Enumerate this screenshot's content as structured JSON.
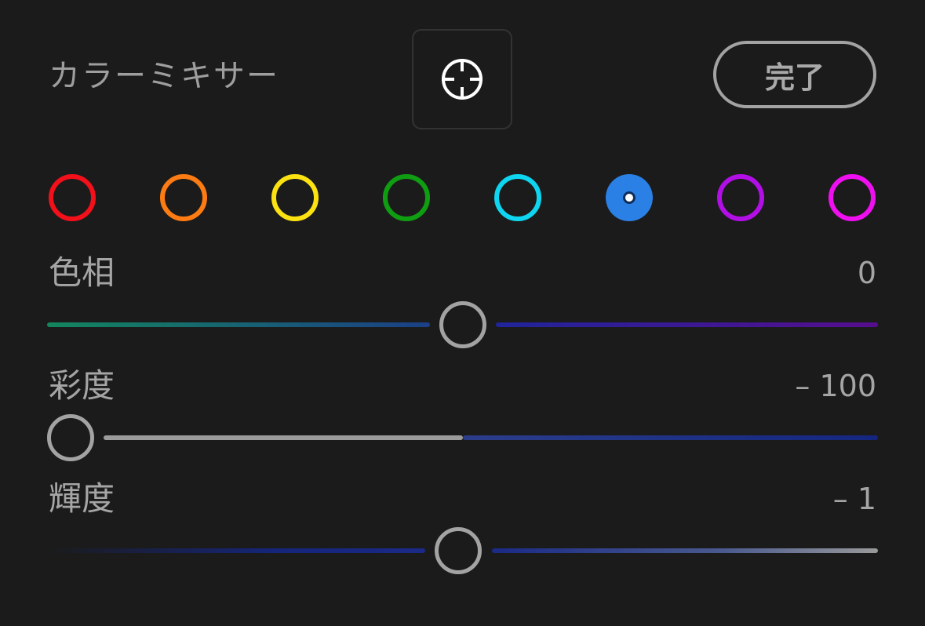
{
  "header": {
    "title": "カラーミキサー",
    "target_tool_icon": "target-crosshair-icon",
    "done_label": "完了"
  },
  "swatches": [
    {
      "name": "red",
      "color": "#f2101a",
      "selected": false
    },
    {
      "name": "orange",
      "color": "#fc7c13",
      "selected": false
    },
    {
      "name": "yellow",
      "color": "#fce211",
      "selected": false
    },
    {
      "name": "green",
      "color": "#0f9e12",
      "selected": false
    },
    {
      "name": "aqua",
      "color": "#0fd6f0",
      "selected": false
    },
    {
      "name": "blue",
      "color": "#2b80e6",
      "selected": true
    },
    {
      "name": "purple",
      "color": "#b20fe6",
      "selected": false
    },
    {
      "name": "magenta",
      "color": "#f00ff0",
      "selected": false
    }
  ],
  "sliders": {
    "hue": {
      "label": "色相",
      "value": "0",
      "position": 0.5
    },
    "saturation": {
      "label": "彩度",
      "value": "– 100",
      "position": 0.0
    },
    "luminance": {
      "label": "輝度",
      "value": "– 1",
      "position": 0.495
    }
  },
  "colors": {
    "background": "#1b1b1b",
    "text": "#a5a5a5",
    "knob_border": "#a3a3a3"
  }
}
